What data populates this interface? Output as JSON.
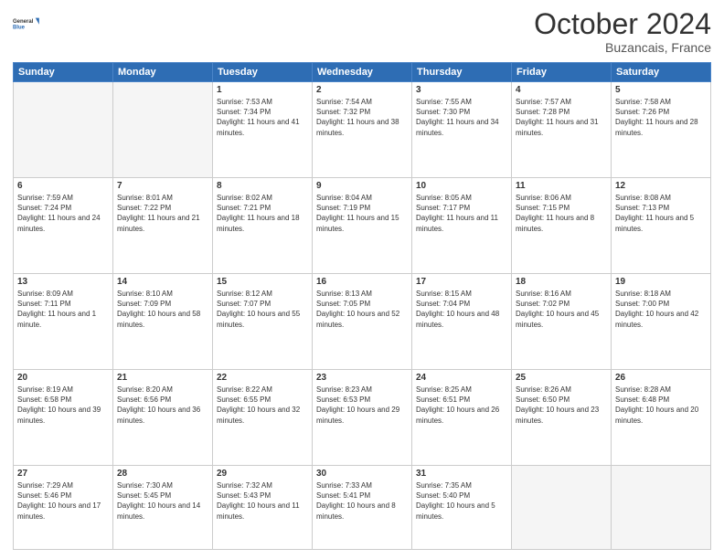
{
  "header": {
    "logo_text_line1": "General",
    "logo_text_line2": "Blue",
    "month": "October 2024",
    "location": "Buzancais, France"
  },
  "weekdays": [
    "Sunday",
    "Monday",
    "Tuesday",
    "Wednesday",
    "Thursday",
    "Friday",
    "Saturday"
  ],
  "weeks": [
    [
      {
        "day": "",
        "sunrise": "",
        "sunset": "",
        "daylight": "",
        "empty": true
      },
      {
        "day": "",
        "sunrise": "",
        "sunset": "",
        "daylight": "",
        "empty": true
      },
      {
        "day": "1",
        "sunrise": "Sunrise: 7:53 AM",
        "sunset": "Sunset: 7:34 PM",
        "daylight": "Daylight: 11 hours and 41 minutes.",
        "empty": false
      },
      {
        "day": "2",
        "sunrise": "Sunrise: 7:54 AM",
        "sunset": "Sunset: 7:32 PM",
        "daylight": "Daylight: 11 hours and 38 minutes.",
        "empty": false
      },
      {
        "day": "3",
        "sunrise": "Sunrise: 7:55 AM",
        "sunset": "Sunset: 7:30 PM",
        "daylight": "Daylight: 11 hours and 34 minutes.",
        "empty": false
      },
      {
        "day": "4",
        "sunrise": "Sunrise: 7:57 AM",
        "sunset": "Sunset: 7:28 PM",
        "daylight": "Daylight: 11 hours and 31 minutes.",
        "empty": false
      },
      {
        "day": "5",
        "sunrise": "Sunrise: 7:58 AM",
        "sunset": "Sunset: 7:26 PM",
        "daylight": "Daylight: 11 hours and 28 minutes.",
        "empty": false
      }
    ],
    [
      {
        "day": "6",
        "sunrise": "Sunrise: 7:59 AM",
        "sunset": "Sunset: 7:24 PM",
        "daylight": "Daylight: 11 hours and 24 minutes.",
        "empty": false
      },
      {
        "day": "7",
        "sunrise": "Sunrise: 8:01 AM",
        "sunset": "Sunset: 7:22 PM",
        "daylight": "Daylight: 11 hours and 21 minutes.",
        "empty": false
      },
      {
        "day": "8",
        "sunrise": "Sunrise: 8:02 AM",
        "sunset": "Sunset: 7:21 PM",
        "daylight": "Daylight: 11 hours and 18 minutes.",
        "empty": false
      },
      {
        "day": "9",
        "sunrise": "Sunrise: 8:04 AM",
        "sunset": "Sunset: 7:19 PM",
        "daylight": "Daylight: 11 hours and 15 minutes.",
        "empty": false
      },
      {
        "day": "10",
        "sunrise": "Sunrise: 8:05 AM",
        "sunset": "Sunset: 7:17 PM",
        "daylight": "Daylight: 11 hours and 11 minutes.",
        "empty": false
      },
      {
        "day": "11",
        "sunrise": "Sunrise: 8:06 AM",
        "sunset": "Sunset: 7:15 PM",
        "daylight": "Daylight: 11 hours and 8 minutes.",
        "empty": false
      },
      {
        "day": "12",
        "sunrise": "Sunrise: 8:08 AM",
        "sunset": "Sunset: 7:13 PM",
        "daylight": "Daylight: 11 hours and 5 minutes.",
        "empty": false
      }
    ],
    [
      {
        "day": "13",
        "sunrise": "Sunrise: 8:09 AM",
        "sunset": "Sunset: 7:11 PM",
        "daylight": "Daylight: 11 hours and 1 minute.",
        "empty": false
      },
      {
        "day": "14",
        "sunrise": "Sunrise: 8:10 AM",
        "sunset": "Sunset: 7:09 PM",
        "daylight": "Daylight: 10 hours and 58 minutes.",
        "empty": false
      },
      {
        "day": "15",
        "sunrise": "Sunrise: 8:12 AM",
        "sunset": "Sunset: 7:07 PM",
        "daylight": "Daylight: 10 hours and 55 minutes.",
        "empty": false
      },
      {
        "day": "16",
        "sunrise": "Sunrise: 8:13 AM",
        "sunset": "Sunset: 7:05 PM",
        "daylight": "Daylight: 10 hours and 52 minutes.",
        "empty": false
      },
      {
        "day": "17",
        "sunrise": "Sunrise: 8:15 AM",
        "sunset": "Sunset: 7:04 PM",
        "daylight": "Daylight: 10 hours and 48 minutes.",
        "empty": false
      },
      {
        "day": "18",
        "sunrise": "Sunrise: 8:16 AM",
        "sunset": "Sunset: 7:02 PM",
        "daylight": "Daylight: 10 hours and 45 minutes.",
        "empty": false
      },
      {
        "day": "19",
        "sunrise": "Sunrise: 8:18 AM",
        "sunset": "Sunset: 7:00 PM",
        "daylight": "Daylight: 10 hours and 42 minutes.",
        "empty": false
      }
    ],
    [
      {
        "day": "20",
        "sunrise": "Sunrise: 8:19 AM",
        "sunset": "Sunset: 6:58 PM",
        "daylight": "Daylight: 10 hours and 39 minutes.",
        "empty": false
      },
      {
        "day": "21",
        "sunrise": "Sunrise: 8:20 AM",
        "sunset": "Sunset: 6:56 PM",
        "daylight": "Daylight: 10 hours and 36 minutes.",
        "empty": false
      },
      {
        "day": "22",
        "sunrise": "Sunrise: 8:22 AM",
        "sunset": "Sunset: 6:55 PM",
        "daylight": "Daylight: 10 hours and 32 minutes.",
        "empty": false
      },
      {
        "day": "23",
        "sunrise": "Sunrise: 8:23 AM",
        "sunset": "Sunset: 6:53 PM",
        "daylight": "Daylight: 10 hours and 29 minutes.",
        "empty": false
      },
      {
        "day": "24",
        "sunrise": "Sunrise: 8:25 AM",
        "sunset": "Sunset: 6:51 PM",
        "daylight": "Daylight: 10 hours and 26 minutes.",
        "empty": false
      },
      {
        "day": "25",
        "sunrise": "Sunrise: 8:26 AM",
        "sunset": "Sunset: 6:50 PM",
        "daylight": "Daylight: 10 hours and 23 minutes.",
        "empty": false
      },
      {
        "day": "26",
        "sunrise": "Sunrise: 8:28 AM",
        "sunset": "Sunset: 6:48 PM",
        "daylight": "Daylight: 10 hours and 20 minutes.",
        "empty": false
      }
    ],
    [
      {
        "day": "27",
        "sunrise": "Sunrise: 7:29 AM",
        "sunset": "Sunset: 5:46 PM",
        "daylight": "Daylight: 10 hours and 17 minutes.",
        "empty": false
      },
      {
        "day": "28",
        "sunrise": "Sunrise: 7:30 AM",
        "sunset": "Sunset: 5:45 PM",
        "daylight": "Daylight: 10 hours and 14 minutes.",
        "empty": false
      },
      {
        "day": "29",
        "sunrise": "Sunrise: 7:32 AM",
        "sunset": "Sunset: 5:43 PM",
        "daylight": "Daylight: 10 hours and 11 minutes.",
        "empty": false
      },
      {
        "day": "30",
        "sunrise": "Sunrise: 7:33 AM",
        "sunset": "Sunset: 5:41 PM",
        "daylight": "Daylight: 10 hours and 8 minutes.",
        "empty": false
      },
      {
        "day": "31",
        "sunrise": "Sunrise: 7:35 AM",
        "sunset": "Sunset: 5:40 PM",
        "daylight": "Daylight: 10 hours and 5 minutes.",
        "empty": false
      },
      {
        "day": "",
        "sunrise": "",
        "sunset": "",
        "daylight": "",
        "empty": true
      },
      {
        "day": "",
        "sunrise": "",
        "sunset": "",
        "daylight": "",
        "empty": true
      }
    ]
  ]
}
